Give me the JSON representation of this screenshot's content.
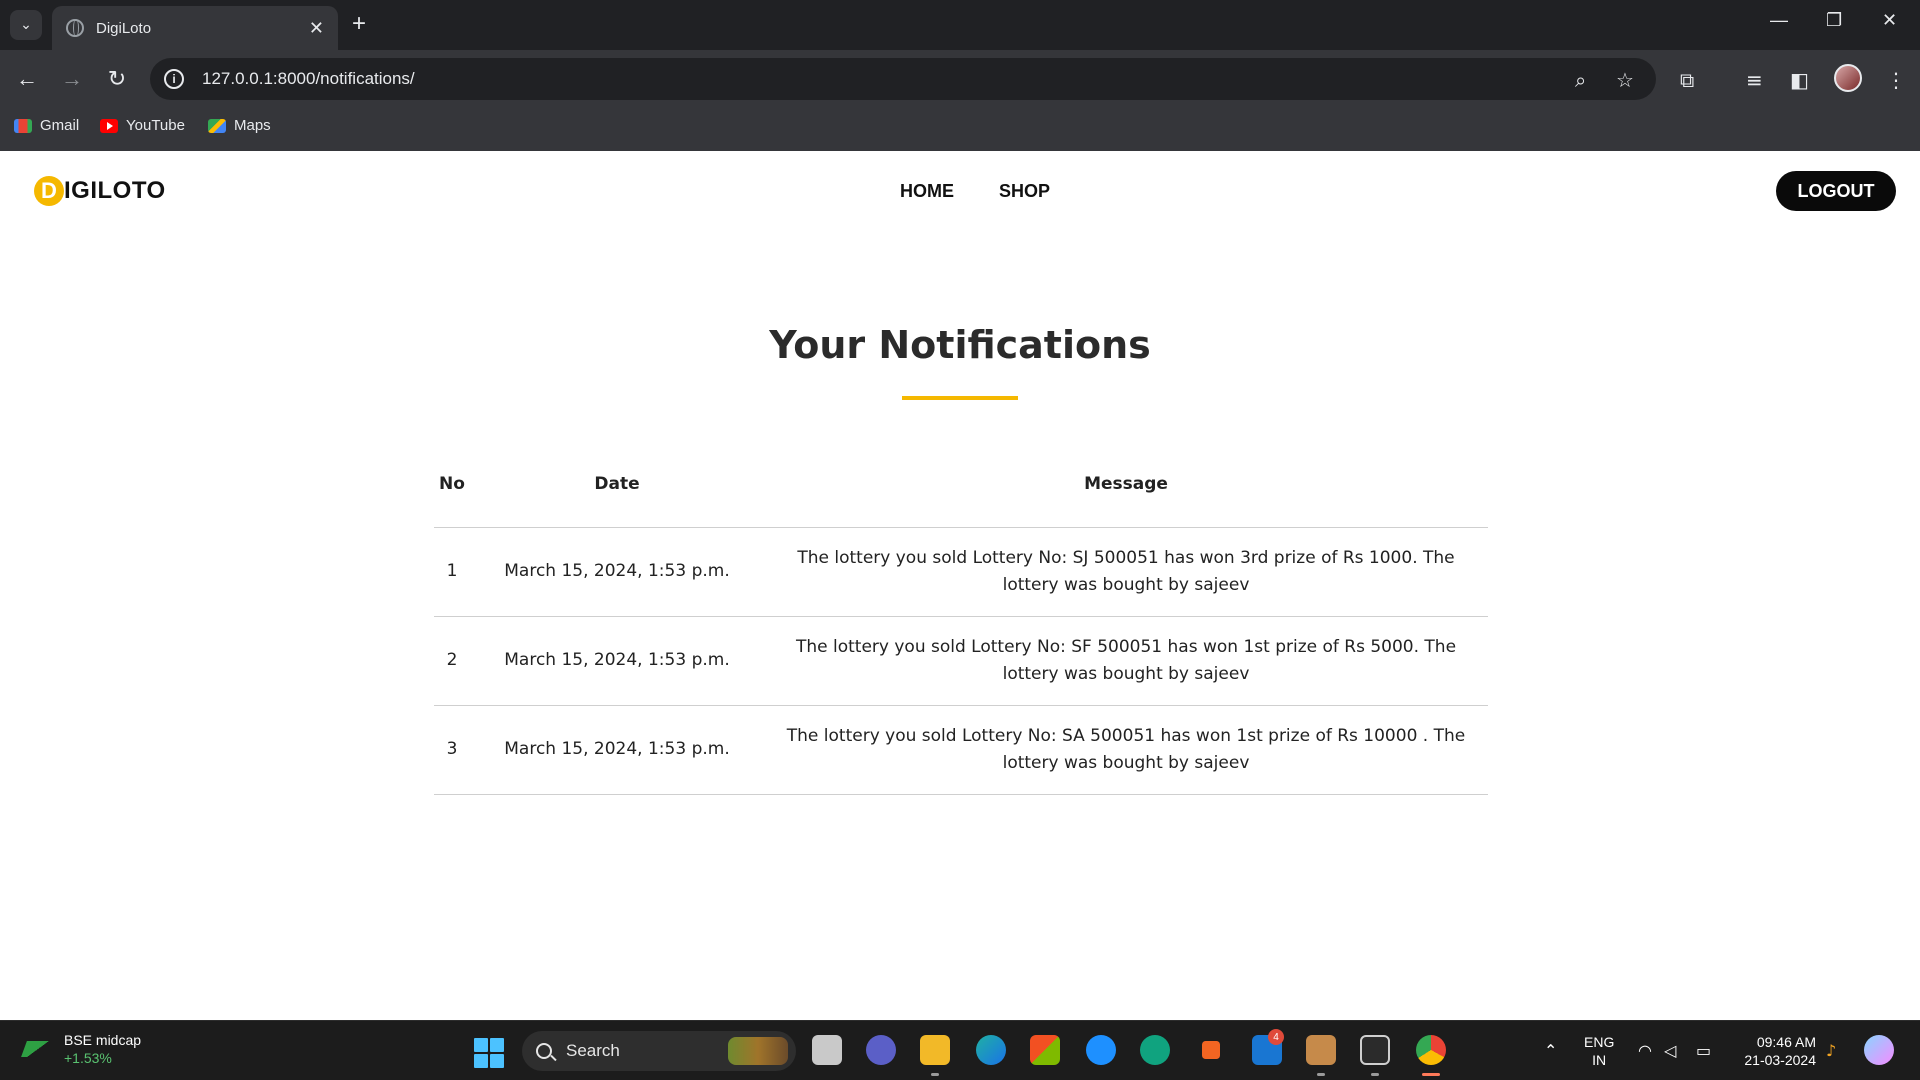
{
  "browser": {
    "tab_title": "DigiLoto",
    "url": "127.0.0.1:8000/notifications/",
    "bookmarks": [
      {
        "label": "Gmail",
        "icon": "gmail-icon"
      },
      {
        "label": "YouTube",
        "icon": "youtube-icon"
      },
      {
        "label": "Maps",
        "icon": "maps-icon"
      }
    ]
  },
  "site": {
    "logo_letter": "D",
    "logo_text": "IGILOTO",
    "nav": [
      "HOME",
      "SHOP"
    ],
    "logout_label": "LOGOUT",
    "accent_color": "#f5b800"
  },
  "main": {
    "heading": "Your Notifications",
    "table": {
      "headers": [
        "No",
        "Date",
        "Message"
      ],
      "rows": [
        {
          "no": "1",
          "date": "March 15, 2024, 1:53 p.m.",
          "message": "The lottery you sold Lottery No: SJ 500051 has won 3rd prize of Rs 1000. The lottery was bought by sajeev"
        },
        {
          "no": "2",
          "date": "March 15, 2024, 1:53 p.m.",
          "message": "The lottery you sold Lottery No: SF 500051 has won 1st prize of Rs 5000. The lottery was bought by sajeev"
        },
        {
          "no": "3",
          "date": "March 15, 2024, 1:53 p.m.",
          "message": "The lottery you sold Lottery No: SA 500051 has won 1st prize of Rs 10000 . The lottery was bought by sajeev"
        }
      ]
    }
  },
  "taskbar": {
    "widget_title": "BSE midcap",
    "widget_change": "+1.53%",
    "search_label": "Search",
    "mail_badge": "4",
    "lang_line1": "ENG",
    "lang_line2": "IN",
    "time": "09:46 AM",
    "date": "21-03-2024"
  }
}
